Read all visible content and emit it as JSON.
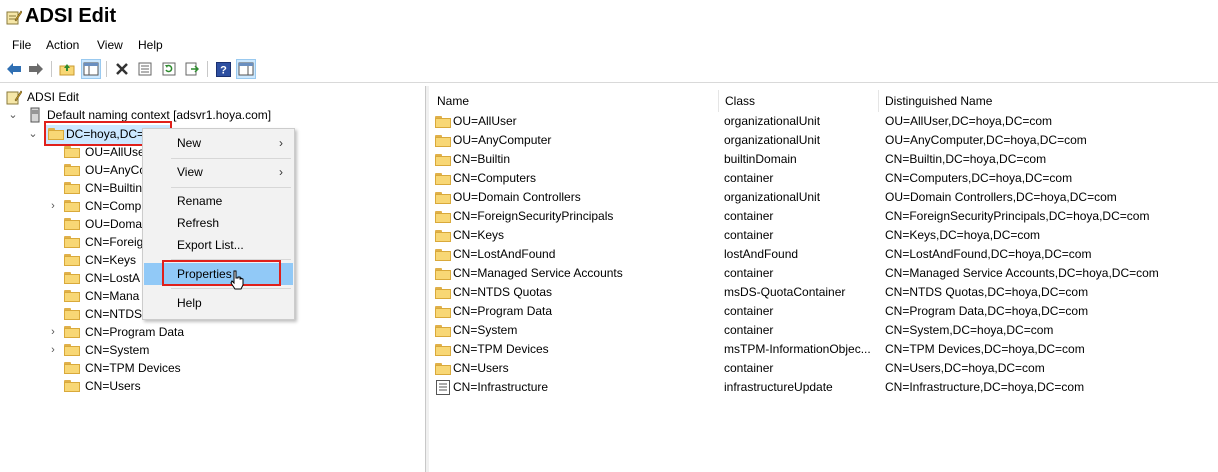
{
  "window": {
    "title": "ADSI Edit"
  },
  "menu": [
    "File",
    "Action",
    "View",
    "Help"
  ],
  "toolbar_icons": [
    "back-arrow-icon",
    "forward-arrow-icon",
    "up-folder-icon",
    "show-hide-tree-icon",
    "delete-icon",
    "properties-icon",
    "refresh-icon",
    "export-list-icon",
    "help-icon",
    "show-hide-action-pane-icon"
  ],
  "tree": {
    "root": "ADSI Edit",
    "context": "Default naming context [adsvr1.hoya.com]",
    "domain": "DC=hoya,DC=com",
    "domain_visible": "DC=hoya,DC=",
    "children": [
      {
        "label": "OU=AllUser",
        "visible": "OU=AllUse",
        "expandable": false
      },
      {
        "label": "OU=AnyComputer",
        "visible": "OU=AnyCo",
        "expandable": false
      },
      {
        "label": "CN=Builtin",
        "visible": "CN=Builtin",
        "expandable": false
      },
      {
        "label": "CN=Computers",
        "visible": "CN=Comp",
        "expandable": true
      },
      {
        "label": "OU=Domain Controllers",
        "visible": "OU=Doma",
        "expandable": false
      },
      {
        "label": "CN=ForeignSecurityPrincipals",
        "visible": "CN=Foreig",
        "expandable": false
      },
      {
        "label": "CN=Keys",
        "visible": "CN=Keys",
        "expandable": false
      },
      {
        "label": "CN=LostAndFound",
        "visible": "CN=LostA",
        "expandable": false
      },
      {
        "label": "CN=Managed Service Accounts",
        "visible": "CN=Mana",
        "expandable": false
      },
      {
        "label": "CN=NTDS Quotas",
        "visible": "CN=NTDS",
        "expandable": false
      },
      {
        "label": "CN=Program Data",
        "visible": "CN=Program Data",
        "expandable": true
      },
      {
        "label": "CN=System",
        "visible": "CN=System",
        "expandable": true
      },
      {
        "label": "CN=TPM Devices",
        "visible": "CN=TPM Devices",
        "expandable": false
      },
      {
        "label": "CN=Users",
        "visible": "CN=Users",
        "expandable": false
      }
    ]
  },
  "list": {
    "columns": [
      "Name",
      "Class",
      "Distinguished Name"
    ],
    "rows": [
      {
        "name": "OU=AllUser",
        "class": "organizationalUnit",
        "dn": "OU=AllUser,DC=hoya,DC=com"
      },
      {
        "name": "OU=AnyComputer",
        "class": "organizationalUnit",
        "dn": "OU=AnyComputer,DC=hoya,DC=com"
      },
      {
        "name": "CN=Builtin",
        "class": "builtinDomain",
        "dn": "CN=Builtin,DC=hoya,DC=com"
      },
      {
        "name": "CN=Computers",
        "class": "container",
        "dn": "CN=Computers,DC=hoya,DC=com"
      },
      {
        "name": "OU=Domain Controllers",
        "class": "organizationalUnit",
        "dn": "OU=Domain Controllers,DC=hoya,DC=com"
      },
      {
        "name": "CN=ForeignSecurityPrincipals",
        "class": "container",
        "dn": "CN=ForeignSecurityPrincipals,DC=hoya,DC=com"
      },
      {
        "name": "CN=Keys",
        "class": "container",
        "dn": "CN=Keys,DC=hoya,DC=com"
      },
      {
        "name": "CN=LostAndFound",
        "class": "lostAndFound",
        "dn": "CN=LostAndFound,DC=hoya,DC=com"
      },
      {
        "name": "CN=Managed Service Accounts",
        "class": "container",
        "dn": "CN=Managed Service Accounts,DC=hoya,DC=com"
      },
      {
        "name": "CN=NTDS Quotas",
        "class": "msDS-QuotaContainer",
        "dn": "CN=NTDS Quotas,DC=hoya,DC=com"
      },
      {
        "name": "CN=Program Data",
        "class": "container",
        "dn": "CN=Program Data,DC=hoya,DC=com"
      },
      {
        "name": "CN=System",
        "class": "container",
        "dn": "CN=System,DC=hoya,DC=com"
      },
      {
        "name": "CN=TPM Devices",
        "class": "msTPM-InformationObjec...",
        "dn": "CN=TPM Devices,DC=hoya,DC=com"
      },
      {
        "name": "CN=Users",
        "class": "container",
        "dn": "CN=Users,DC=hoya,DC=com"
      },
      {
        "name": "CN=Infrastructure",
        "class": "infrastructureUpdate",
        "dn": "CN=Infrastructure,DC=hoya,DC=com",
        "icon": "document-icon"
      }
    ]
  },
  "context_menu": {
    "items": [
      {
        "label": "New",
        "submenu": true
      },
      {
        "label": "View",
        "submenu": true
      },
      {
        "label": "Rename",
        "submenu": false
      },
      {
        "label": "Refresh",
        "submenu": false
      },
      {
        "label": "Export List...",
        "submenu": false
      },
      {
        "label": "Properties",
        "submenu": false,
        "highlighted": true
      },
      {
        "label": "Help",
        "submenu": false
      }
    ],
    "submenu_arrow": "›"
  },
  "colors": {
    "highlight_red": "#e0201b",
    "menu_highlight": "#91c9f7",
    "folder": "#f8d775"
  }
}
